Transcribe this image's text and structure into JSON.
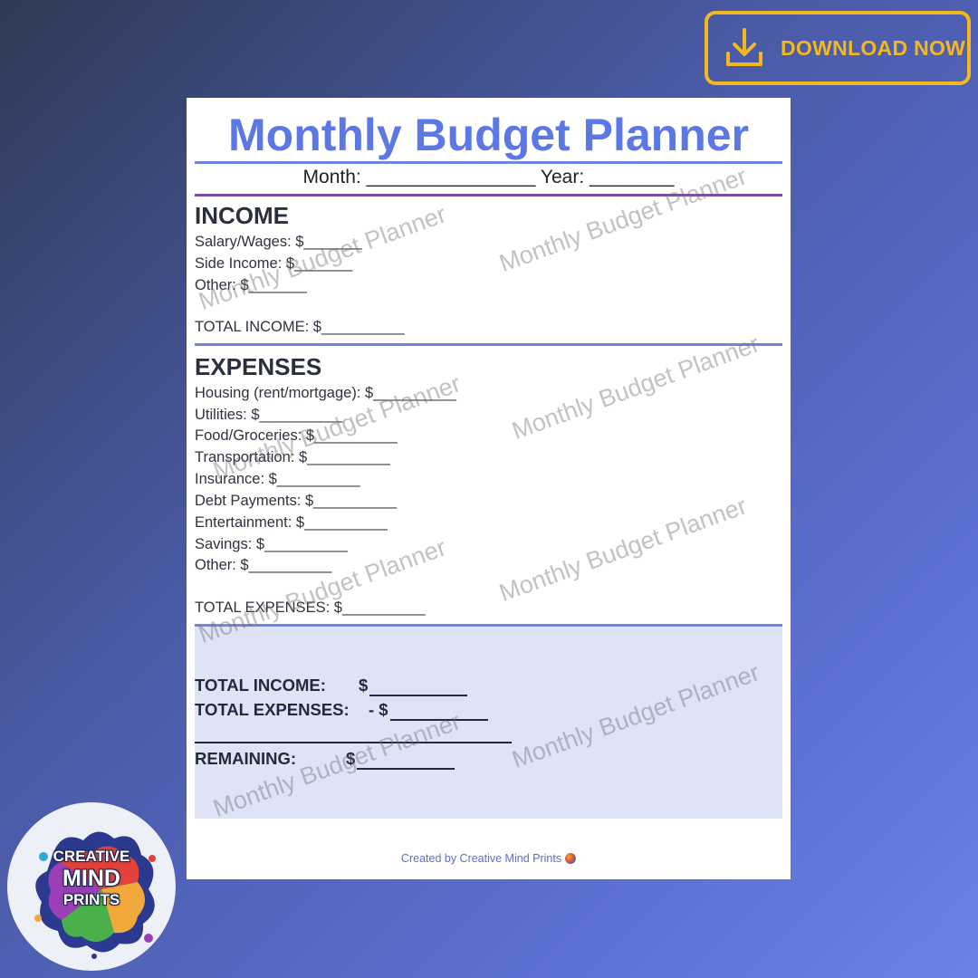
{
  "download": {
    "label": "DOWNLOAD NOW",
    "icon": "download-icon",
    "color": "#f4b81e"
  },
  "page": {
    "title": "Monthly Budget Planner",
    "month_line": "Month: ________________ Year: ________",
    "income": {
      "heading": "INCOME",
      "items": [
        "Salary/Wages: $_______",
        "Side Income: $_______",
        "Other: $_______"
      ],
      "total": "TOTAL INCOME: $__________"
    },
    "expenses": {
      "heading": "EXPENSES",
      "items": [
        "Housing (rent/mortgage): $__________",
        "Utilities: $__________",
        "Food/Groceries: $__________",
        "Transportation: $__________",
        "Insurance: $__________",
        "Debt Payments: $__________",
        "Entertainment: $__________",
        "Savings: $__________",
        "Other: $__________"
      ],
      "total": "TOTAL EXPENSES: $__________"
    },
    "summary": {
      "total_income_label": "TOTAL INCOME:",
      "total_income_value": "$",
      "total_expenses_label": "TOTAL EXPENSES:",
      "total_expenses_value": "- $",
      "remaining_label": "REMAINING:",
      "remaining_value": "$"
    },
    "footer": "Created by Creative Mind Prints",
    "watermark": "Monthly Budget Planner"
  },
  "logo": {
    "line1": "CREATIVE",
    "line2": "MIND",
    "line3": "PRINTS"
  },
  "colors": {
    "title": "#5b78e4",
    "rule_blue": "#6f86df",
    "rule_purple": "#7a4ea6",
    "summary_bg": "#dfe3f8"
  }
}
